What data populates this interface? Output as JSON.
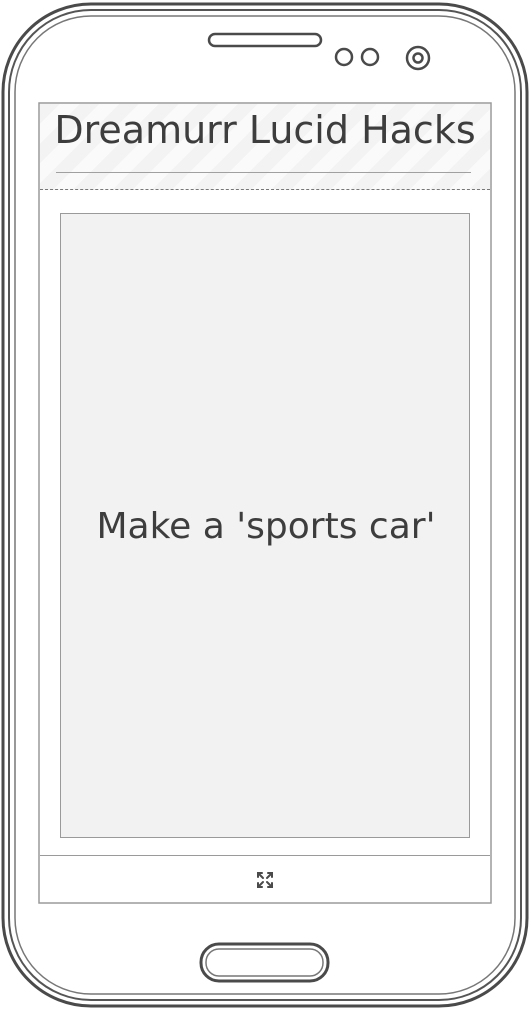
{
  "app": {
    "title": "Dreamurr Lucid Hacks"
  },
  "card": {
    "text": "Make a 'sports car'"
  },
  "footer": {
    "expand_icon": "expand-icon"
  },
  "colors": {
    "outline": "#4a4a4a",
    "text": "#3d3d3d",
    "card_background": "#f2f2f2",
    "card_border": "#9a9a9a",
    "header_stripe_light": "#fafafa",
    "header_stripe_dark": "#f3f3f3"
  }
}
